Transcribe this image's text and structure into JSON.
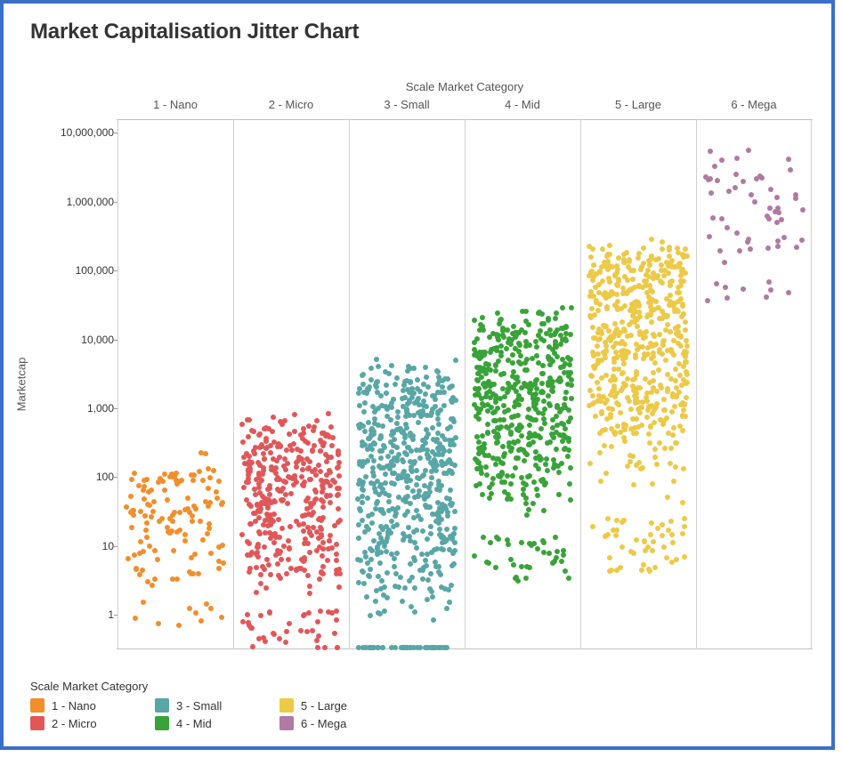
{
  "title": "Market Capitalisation Jitter Chart",
  "xTitle": "Scale Market Category",
  "yTitle": "Marketcap",
  "yTicks": [
    1,
    10,
    100,
    1000,
    10000,
    100000,
    1000000,
    10000000
  ],
  "yTickLabels": [
    "1",
    "10",
    "100",
    "1,000",
    "10,000",
    "100,000",
    "1,000,000",
    "10,000,000"
  ],
  "yLogRange": [
    -0.5,
    7.2
  ],
  "categories": [
    {
      "label": "1 - Nano",
      "color": "#F28E2B",
      "n": 130,
      "loMin": 0.3,
      "loMax": 0.6,
      "hiMin": 1.9,
      "hiMax": 2.4
    },
    {
      "label": "2 - Micro",
      "color": "#E15759",
      "n": 420,
      "loMin": 0.2,
      "loMax": 0.7,
      "hiMin": 2.5,
      "hiMax": 3.0
    },
    {
      "label": "3 - Small",
      "color": "#59A6A6",
      "n": 620,
      "loMin": -0.4,
      "loMax": 0.9,
      "hiMin": 3.3,
      "hiMax": 3.75
    },
    {
      "label": "4 - Mid",
      "color": "#39A339",
      "n": 520,
      "loMin": 1.3,
      "loMax": 2.0,
      "hiMin": 4.1,
      "hiMax": 4.5
    },
    {
      "label": "5 - Large",
      "color": "#EDC948",
      "n": 620,
      "loMin": 1.6,
      "loMax": 3.0,
      "hiMin": 5.2,
      "hiMax": 5.5
    },
    {
      "label": "6 - Mega",
      "color": "#B07AA1",
      "n": 60,
      "loMin": 5.0,
      "loMax": 5.3,
      "hiMin": 6.4,
      "hiMax": 6.9
    }
  ],
  "legend": {
    "title": "Scale Market Category",
    "items": [
      {
        "label": "1 - Nano",
        "color": "#F28E2B"
      },
      {
        "label": "3 - Small",
        "color": "#59A6A6"
      },
      {
        "label": "5 - Large",
        "color": "#EDC948"
      },
      {
        "label": "2 - Micro",
        "color": "#E15759"
      },
      {
        "label": "4 - Mid",
        "color": "#39A339"
      },
      {
        "label": "6 - Mega",
        "color": "#B07AA1"
      }
    ]
  },
  "chart_data": {
    "type": "scatter",
    "title": "Market Capitalisation Jitter Chart",
    "xlabel": "Scale Market Category",
    "ylabel": "Marketcap",
    "y_scale": "log10",
    "ylim": [
      0.3,
      16000000
    ],
    "categories": [
      "1 - Nano",
      "2 - Micro",
      "3 - Small",
      "4 - Mid",
      "5 - Large",
      "6 - Mega"
    ],
    "series": [
      {
        "name": "1 - Nano",
        "color": "#F28E2B",
        "approx_count": 130,
        "value_range": [
          2,
          250
        ]
      },
      {
        "name": "2 - Micro",
        "color": "#E15759",
        "approx_count": 420,
        "value_range": [
          1.5,
          1000
        ]
      },
      {
        "name": "3 - Small",
        "color": "#59A6A6",
        "approx_count": 620,
        "value_range": [
          0.4,
          6000
        ]
      },
      {
        "name": "4 - Mid",
        "color": "#39A339",
        "approx_count": 520,
        "value_range": [
          20,
          30000
        ]
      },
      {
        "name": "5 - Large",
        "color": "#EDC948",
        "approx_count": 620,
        "value_range": [
          40,
          350000
        ]
      },
      {
        "name": "6 - Mega",
        "color": "#B07AA1",
        "approx_count": 60,
        "value_range": [
          100000,
          8000000
        ]
      }
    ],
    "note": "Jittered strip plot; x is category with random horizontal jitter, y is market cap on log scale. Individual point values are not labeled in the source image."
  }
}
